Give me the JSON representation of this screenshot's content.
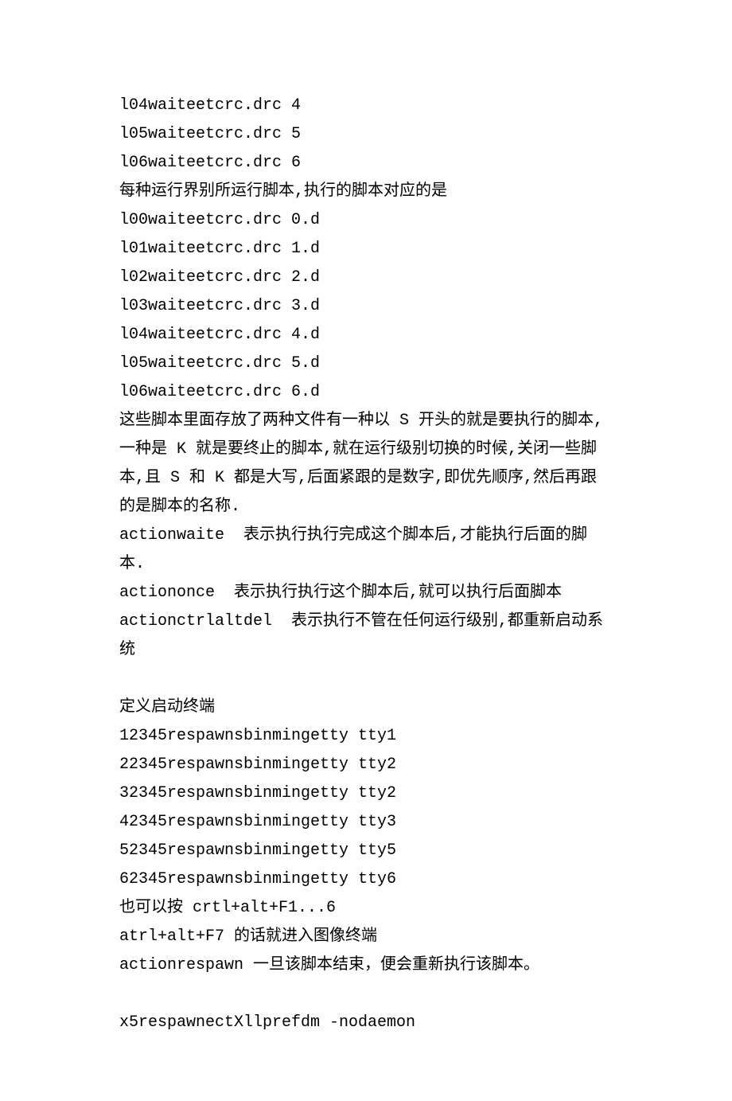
{
  "lines": [
    "l04waiteetcrc.drc 4",
    "l05waiteetcrc.drc 5",
    "l06waiteetcrc.drc 6",
    "每种运行界别所运行脚本,执行的脚本对应的是",
    "l00waiteetcrc.drc 0.d",
    "l01waiteetcrc.drc 1.d",
    "l02waiteetcrc.drc 2.d",
    "l03waiteetcrc.drc 3.d",
    "l04waiteetcrc.drc 4.d",
    "l05waiteetcrc.drc 5.d",
    "l06waiteetcrc.drc 6.d",
    "这些脚本里面存放了两种文件有一种以 S 开头的就是要执行的脚本,一种是 K 就是要终止的脚本,就在运行级别切换的时候,关闭一些脚本,且 S 和 K 都是大写,后面紧跟的是数字,即优先顺序,然后再跟的是脚本的名称.",
    "actionwaite  表示执行执行完成这个脚本后,才能执行后面的脚本.",
    "actiononce  表示执行执行这个脚本后,就可以执行后面脚本",
    "actionctrlaltdel  表示执行不管在任何运行级别,都重新启动系统",
    "",
    "定义启动终端",
    "12345respawnsbinmingetty tty1",
    "22345respawnsbinmingetty tty2",
    "32345respawnsbinmingetty tty2",
    "42345respawnsbinmingetty tty3",
    "52345respawnsbinmingetty tty5",
    "62345respawnsbinmingetty tty6",
    "也可以按 crtl+alt+F1...6",
    "atrl+alt+F7 的话就进入图像终端",
    "actionrespawn 一旦该脚本结束，便会重新执行该脚本。",
    "",
    "x5respawnectXllprefdm -nodaemon"
  ]
}
